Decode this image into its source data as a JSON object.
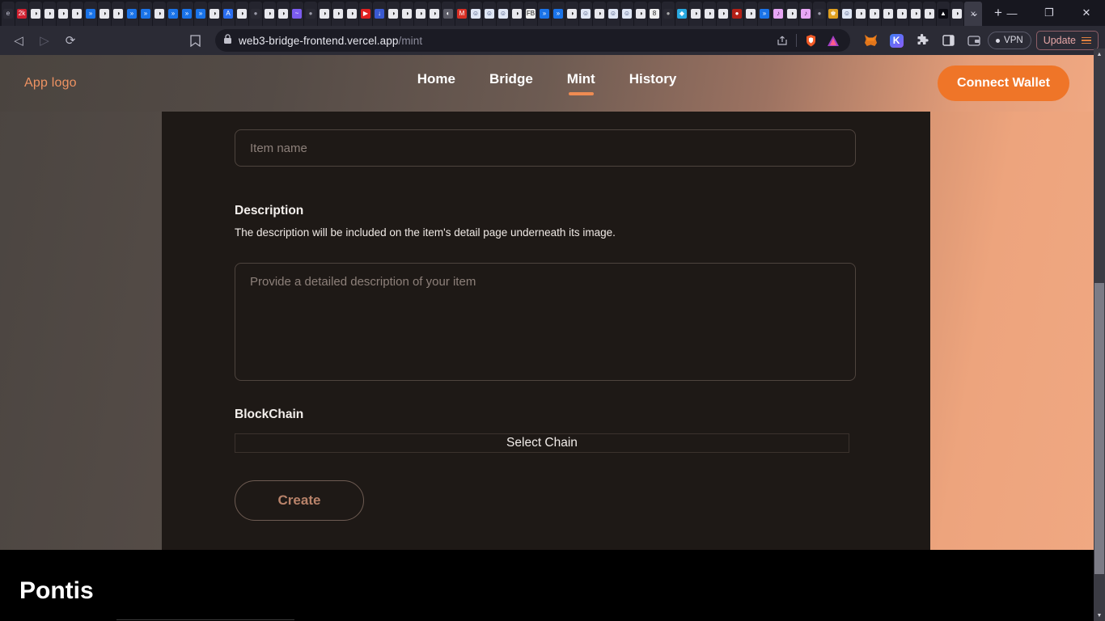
{
  "browser": {
    "tabs_note": "many-pinned-tabs",
    "active_tab_close": "×",
    "new_tab": "+",
    "window_controls": {
      "tab_search": "⌄",
      "minimize": "—",
      "maximize": "❐",
      "close": "✕"
    },
    "nav": {
      "back": "◁",
      "forward": "▷",
      "reload": "⟳",
      "bookmark": "☐"
    },
    "url": {
      "lock": "ὑ2",
      "domain": "web3-bridge-frontend.vercel.app",
      "path": "/mint"
    },
    "url_actions": {
      "share": "share-icon",
      "shield": "brave-shield-icon",
      "rewards": "brave-rewards-icon"
    },
    "toolbar_right": {
      "metamask": "🦊",
      "kagi": "K",
      "extensions": "extensions-puzzle-icon",
      "sidebar": "sidebar-icon",
      "wallet": "wallet-icon",
      "vpn_label": "VPN",
      "update_label": "Update"
    }
  },
  "site": {
    "logo": "App logo",
    "nav_items": [
      {
        "label": "Home",
        "active": false
      },
      {
        "label": "Bridge",
        "active": false
      },
      {
        "label": "Mint",
        "active": true
      },
      {
        "label": "History",
        "active": false
      }
    ],
    "connect_wallet": "Connect Wallet",
    "accent": "#ef7528"
  },
  "form": {
    "item_name_placeholder": "Item name",
    "item_name_value": "",
    "description_title": "Description",
    "description_help": "The description will be included on the item's detail page underneath its image.",
    "description_placeholder": "Provide a detailed description of your item",
    "description_value": "",
    "blockchain_label": "BlockChain",
    "select_chain_label": "Select Chain",
    "create_label": "Create"
  },
  "footer": {
    "title": "Pontis"
  }
}
